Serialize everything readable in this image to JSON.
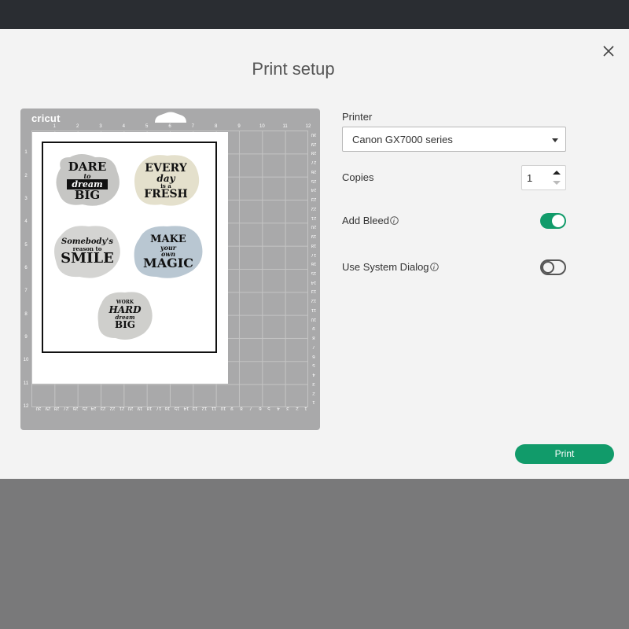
{
  "dialog": {
    "title": "Print setup",
    "close_icon": "close-icon"
  },
  "mat": {
    "brand": "cricut",
    "ruler_top": [
      "1",
      "2",
      "3",
      "4",
      "5",
      "6",
      "7",
      "8",
      "9",
      "10",
      "11",
      "12"
    ],
    "ruler_left": [
      "1",
      "2",
      "3",
      "4",
      "5",
      "6",
      "7",
      "8",
      "9",
      "10",
      "11",
      "12"
    ],
    "ruler_right": [
      "30",
      "29",
      "28",
      "27",
      "26",
      "25",
      "24",
      "23",
      "22",
      "21",
      "20",
      "19",
      "18",
      "17",
      "16",
      "15",
      "14",
      "13",
      "12",
      "11",
      "10",
      "9",
      "8",
      "7",
      "6",
      "5",
      "4",
      "3",
      "2",
      "1"
    ],
    "ruler_bottom": [
      "30",
      "29",
      "28",
      "27",
      "26",
      "25",
      "24",
      "23",
      "22",
      "21",
      "20",
      "19",
      "18",
      "17",
      "16",
      "15",
      "14",
      "13",
      "12",
      "11",
      "10",
      "9",
      "8",
      "7",
      "6",
      "5",
      "4",
      "3",
      "2",
      "1"
    ],
    "stickers": [
      {
        "line1": "DARE",
        "line2": "to",
        "line3": "dream",
        "line4": "BIG",
        "bg": "#c6c6c4"
      },
      {
        "line1": "EVERY",
        "line2": "day",
        "line3": "is a",
        "line4": "FRESH",
        "bg": "#e4e0cc"
      },
      {
        "line1": "Somebody's",
        "line2": "reason to",
        "line3": "SMILE",
        "line4": "",
        "bg": "#d4d4d2"
      },
      {
        "line1": "MAKE",
        "line2": "your",
        "line3": "own",
        "line4": "MAGIC",
        "bg": "#b9c7d2"
      },
      {
        "line1": "WORK",
        "line2": "HARD",
        "line3": "dream",
        "line4": "BIG",
        "bg": "#cfcfcc"
      }
    ]
  },
  "form": {
    "printer_label": "Printer",
    "printer_value": "Canon GX7000 series",
    "copies_label": "Copies",
    "copies_value": "1",
    "bleed_label": "Add Bleed",
    "bleed_on": true,
    "system_dialog_label": "Use System Dialog",
    "system_dialog_on": false,
    "print_label": "Print"
  },
  "colors": {
    "accent": "#119b6a",
    "mat": "#a9a9aa",
    "topbar": "#2a2d32"
  }
}
